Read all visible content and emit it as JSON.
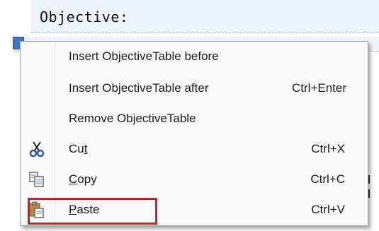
{
  "background": {
    "title": "Objective:"
  },
  "menu": {
    "items": [
      {
        "label": "Insert ObjectiveTable before",
        "shortcut": ""
      },
      {
        "label": "Insert ObjectiveTable after",
        "shortcut": "Ctrl+Enter"
      },
      {
        "label": "Remove ObjectiveTable",
        "shortcut": ""
      },
      {
        "label_pre": "Cu",
        "label_mnemonic": "t",
        "label_post": "",
        "shortcut": "Ctrl+X",
        "icon": "scissors-icon"
      },
      {
        "label_pre": "",
        "label_mnemonic": "C",
        "label_post": "opy",
        "shortcut": "Ctrl+C",
        "icon": "copy-icon"
      },
      {
        "label_pre": "",
        "label_mnemonic": "P",
        "label_post": "aste",
        "shortcut": "Ctrl+V",
        "icon": "paste-icon"
      }
    ]
  },
  "colors": {
    "highlight": "#c0272d",
    "selection_handle": "#3d74c4"
  }
}
